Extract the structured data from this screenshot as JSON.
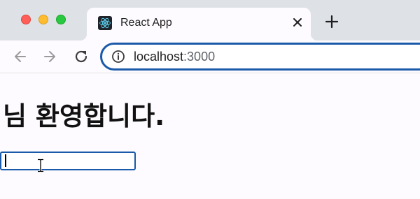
{
  "window_controls": [
    "close",
    "minimize",
    "zoom"
  ],
  "tab": {
    "favicon": "react-logo-icon",
    "title": "React App",
    "close_icon": "close-icon"
  },
  "new_tab_icon": "plus-icon",
  "toolbar": {
    "back_icon": "arrow-left-icon",
    "forward_icon": "arrow-right-icon",
    "reload_icon": "reload-icon",
    "info_icon": "info-icon",
    "url_host": "localhost",
    "url_port": ":3000"
  },
  "page": {
    "heading": "님 환영합니다.",
    "name_input_value": ""
  },
  "colors": {
    "tabstrip": "#dee1e6",
    "page_background": "#fdfbff",
    "focus_ring": "#1a5aa8"
  }
}
